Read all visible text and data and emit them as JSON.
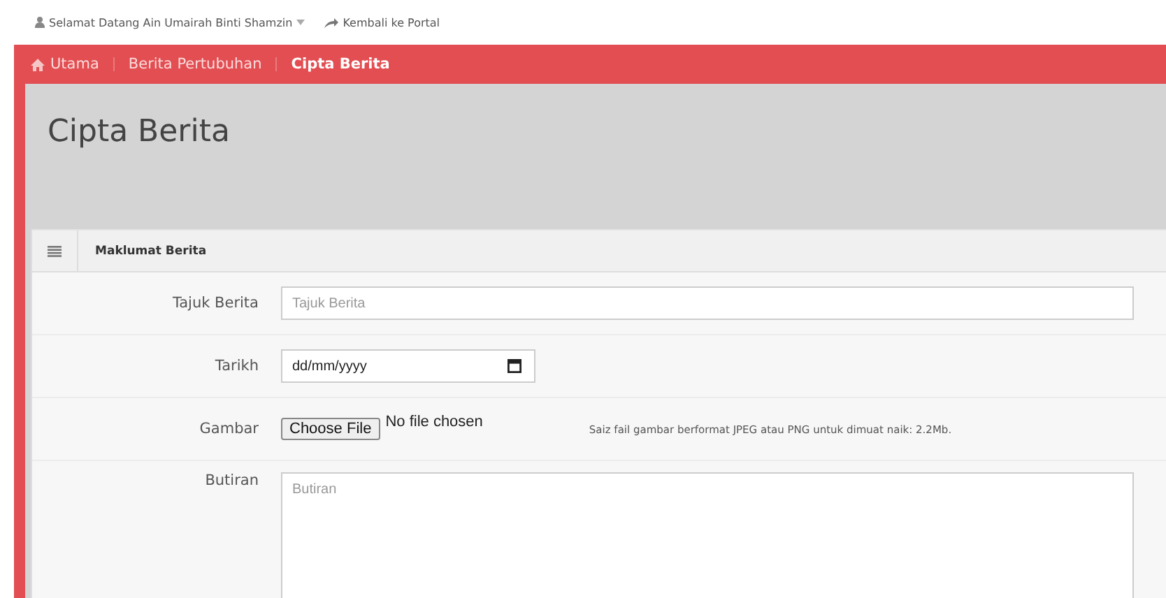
{
  "top_bar": {
    "welcome": "Selamat Datang Ain Umairah Binti Shamzin",
    "portal_link": "Kembali ke Portal"
  },
  "breadcrumb": [
    {
      "label": "Utama",
      "selected": false
    },
    {
      "label": "Berita Pertubuhan",
      "selected": false
    },
    {
      "label": "Cipta Berita",
      "selected": true
    }
  ],
  "page_title": "Cipta Berita",
  "panel": {
    "title": "Maklumat Berita",
    "fields": [
      {
        "kind": "text",
        "label": "Tajuk Berita",
        "placeholder": "Tajuk Berita"
      },
      {
        "kind": "date",
        "label": "Tarikh",
        "value": "dd/mm/yyyy"
      },
      {
        "kind": "file",
        "label": "Gambar",
        "button": "Choose File",
        "status": "No file chosen",
        "help": "Saiz fail gambar berformat JPEG atau PNG untuk dimuat naik: 2.2Mb."
      },
      {
        "kind": "textarea",
        "label": "Butiran",
        "placeholder": "Butiran"
      }
    ]
  }
}
